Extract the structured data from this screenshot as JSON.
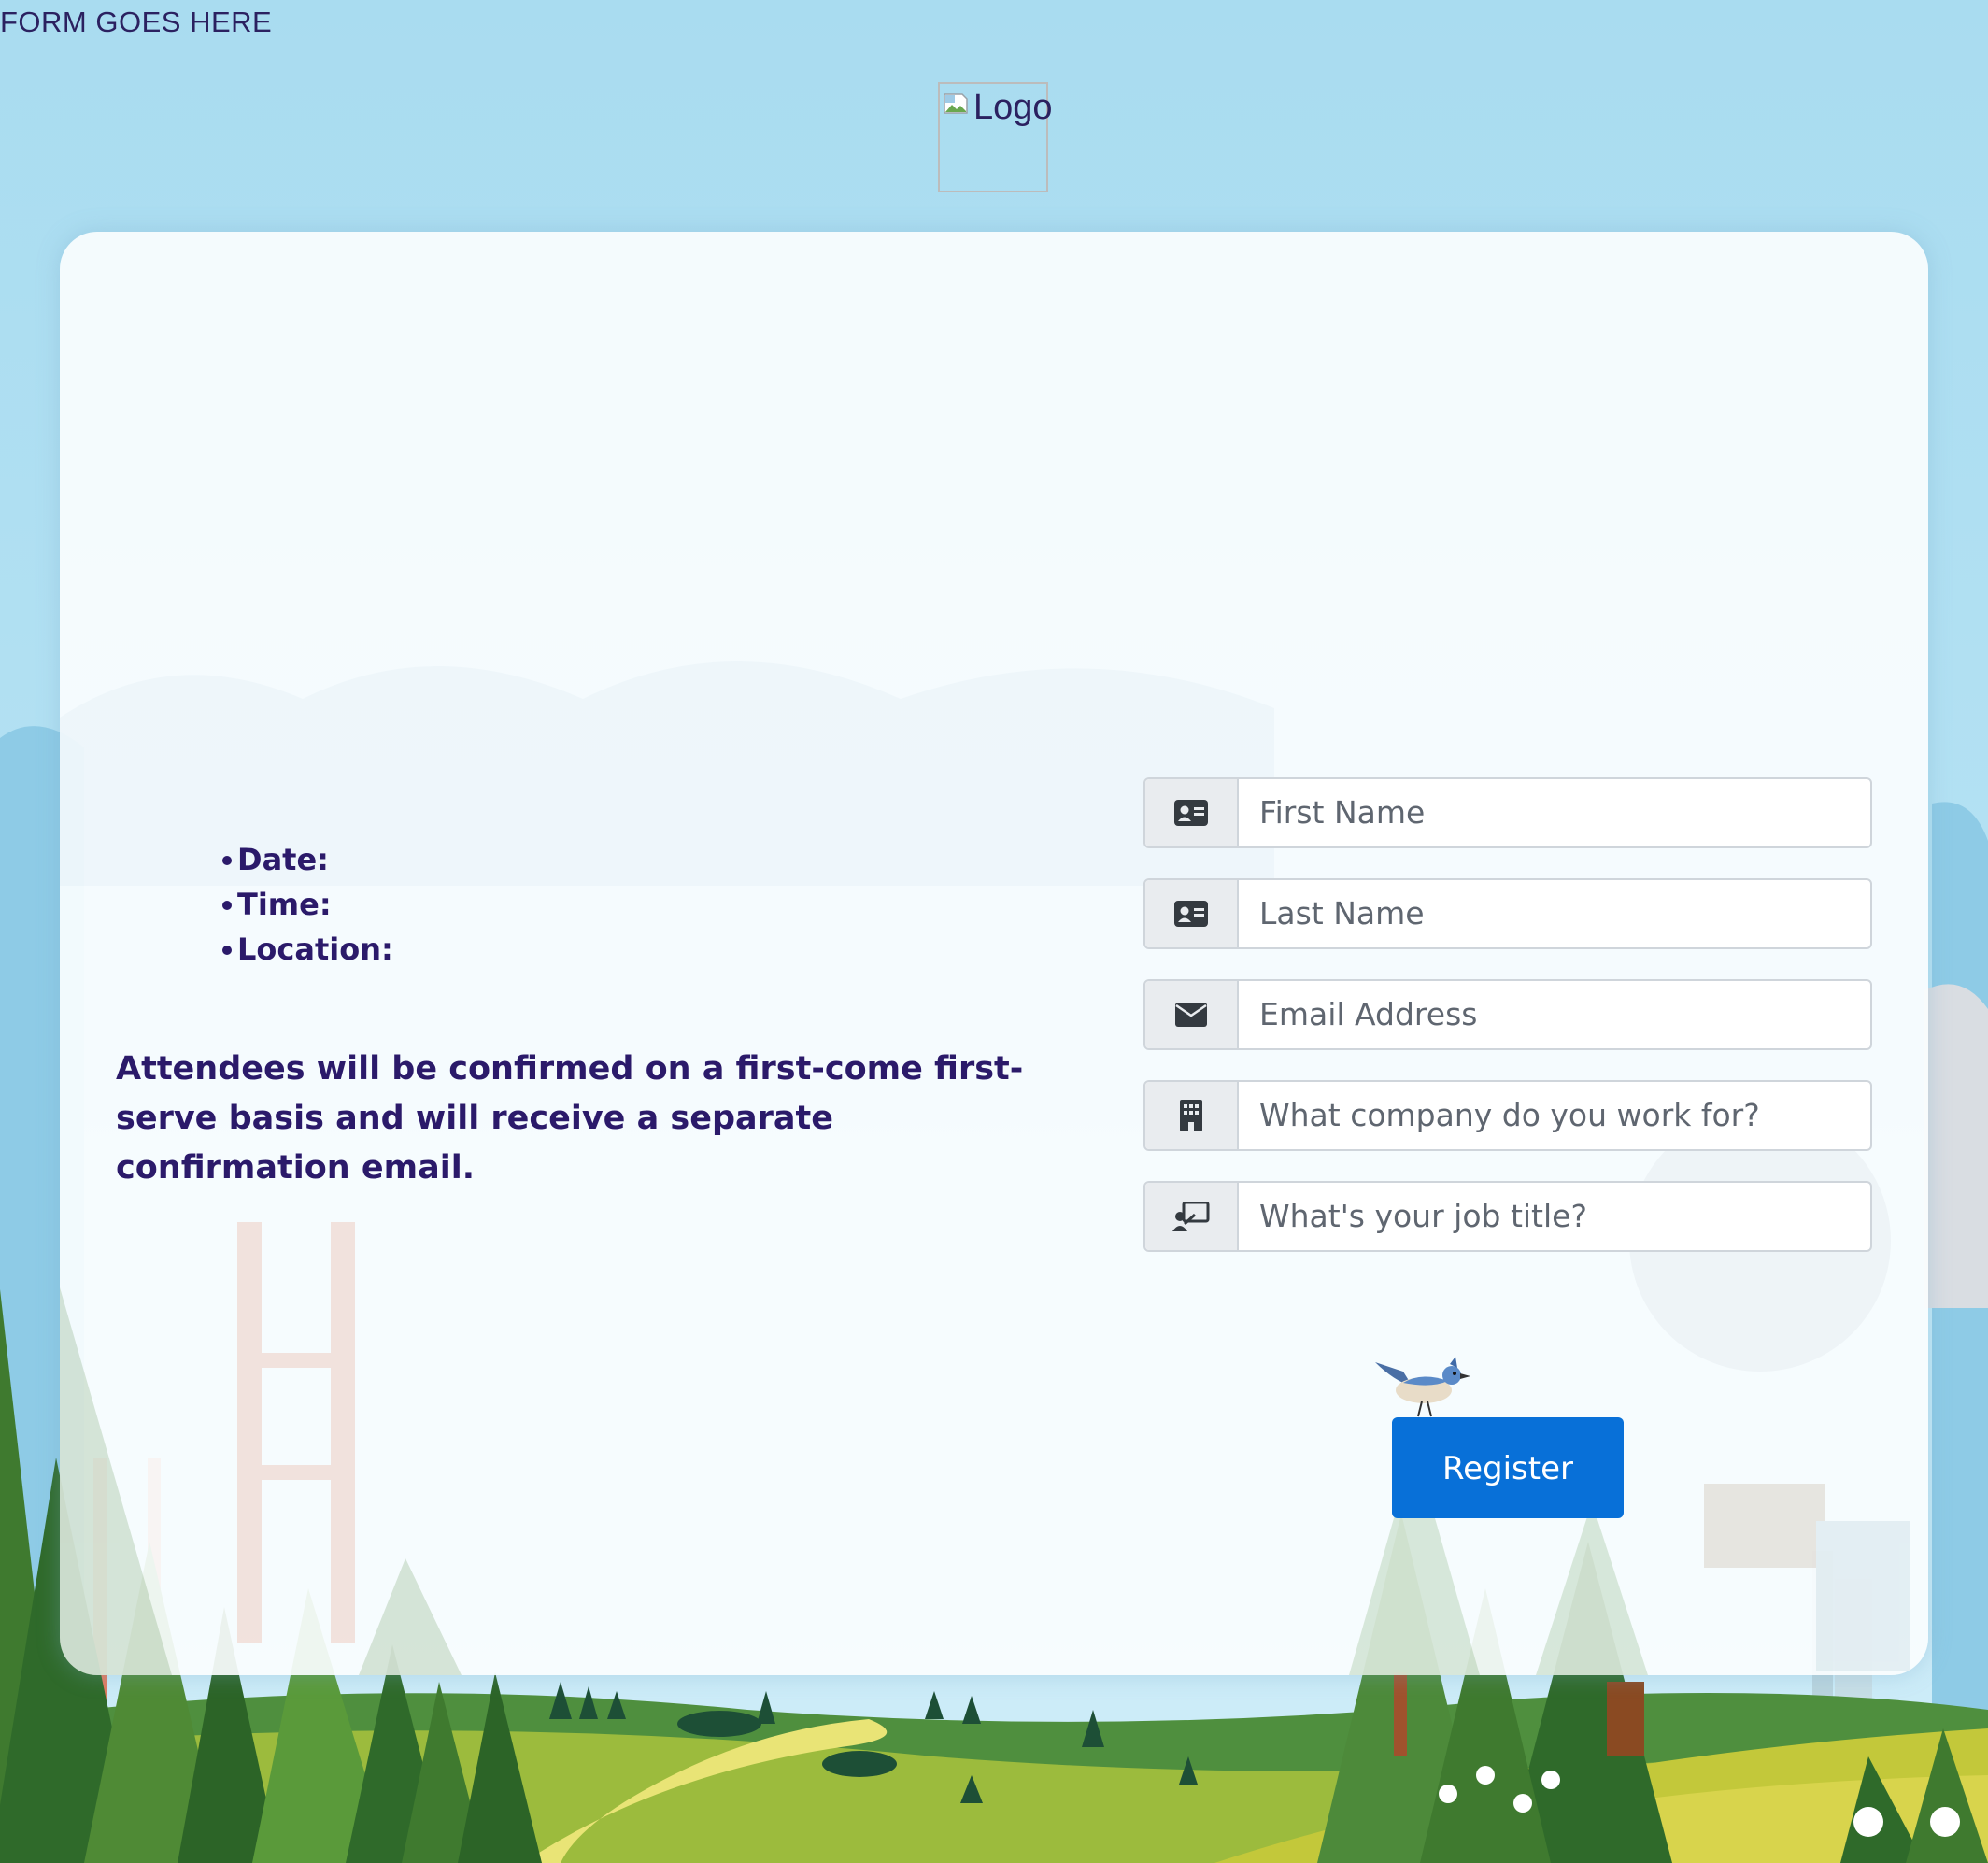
{
  "page": {
    "top_text": "FORM GOES HERE",
    "logo_alt": "Logo"
  },
  "event": {
    "details": [
      {
        "label": "Date:"
      },
      {
        "label": "Time:"
      },
      {
        "label": "Location:"
      }
    ],
    "notice": "Attendees will be confirmed on a first-come first-serve basis and will receive a separate confirmation email."
  },
  "form": {
    "fields": [
      {
        "name": "first-name",
        "placeholder": "First Name",
        "icon": "id-card-icon",
        "value": ""
      },
      {
        "name": "last-name",
        "placeholder": "Last Name",
        "icon": "id-card-icon",
        "value": ""
      },
      {
        "name": "email",
        "placeholder": "Email Address",
        "icon": "envelope-icon",
        "value": ""
      },
      {
        "name": "company",
        "placeholder": "What company do you work for?",
        "icon": "building-icon",
        "value": ""
      },
      {
        "name": "job-title",
        "placeholder": "What's your job title?",
        "icon": "presenter-icon",
        "value": ""
      }
    ],
    "submit_label": "Register"
  },
  "colors": {
    "sky": "#a9dcf0",
    "heading_text": "#2b1a6a",
    "button": "#0870d8",
    "input_addon": "#e9ecef"
  }
}
